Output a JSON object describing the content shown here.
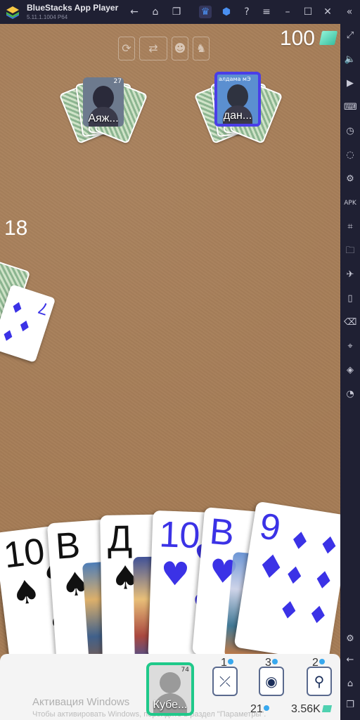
{
  "app": {
    "title": "BlueStacks App Player",
    "version": "5.11.1.1004  P64"
  },
  "titlebar_icons": [
    "back-icon",
    "home-icon",
    "multi-instance-icon",
    "crown-icon",
    "shield-icon",
    "help-icon",
    "menu-icon",
    "minimize-icon",
    "maximize-icon",
    "close-icon",
    "collapse-icon"
  ],
  "sidebar_icons": [
    "fullscreen-icon",
    "volume-icon",
    "media-icon",
    "keyboard-icon",
    "record-icon",
    "sync-icon",
    "macro-icon",
    "apk-icon",
    "screenshot-icon",
    "folder-icon",
    "airplane-icon",
    "rotate-icon",
    "erase-icon",
    "location-icon",
    "layers-icon",
    "performance-icon",
    "settings-icon",
    "back-icon",
    "home-icon",
    "recent-apps-icon"
  ],
  "game": {
    "coins": "100",
    "deck_count": "18",
    "opponents": [
      {
        "name": "Аяж...",
        "level": "27"
      },
      {
        "name": "дан...",
        "caption": "алдама мЭ"
      }
    ],
    "hand": [
      {
        "rank": "10",
        "suit": "♠",
        "color": "#111111"
      },
      {
        "rank": "В",
        "suit": "♠",
        "color": "#111111"
      },
      {
        "rank": "Д",
        "suit": "♠",
        "color": "#111111"
      },
      {
        "rank": "10",
        "suit": "♥",
        "color": "#3b32e6"
      },
      {
        "rank": "В",
        "suit": "♥",
        "color": "#3b32e6"
      },
      {
        "rank": "9",
        "suit": "♦",
        "color": "#3b32e6"
      }
    ],
    "table_card": {
      "rank": "7",
      "suit": "♦"
    }
  },
  "player": {
    "name": "Кубе...",
    "level": "74",
    "boosts": [
      {
        "count": "1",
        "icon": "swap-card-icon"
      },
      {
        "count": "3",
        "icon": "eye-card-icon"
      },
      {
        "count": "2",
        "icon": "magnify-card-icon"
      }
    ],
    "stat_gems": "21",
    "stat_coins": "3.56K"
  },
  "watermark": {
    "title": "Активация Windows",
    "subtitle": "Чтобы активировать Windows, перейдите в раздел \"Параметры\"."
  }
}
